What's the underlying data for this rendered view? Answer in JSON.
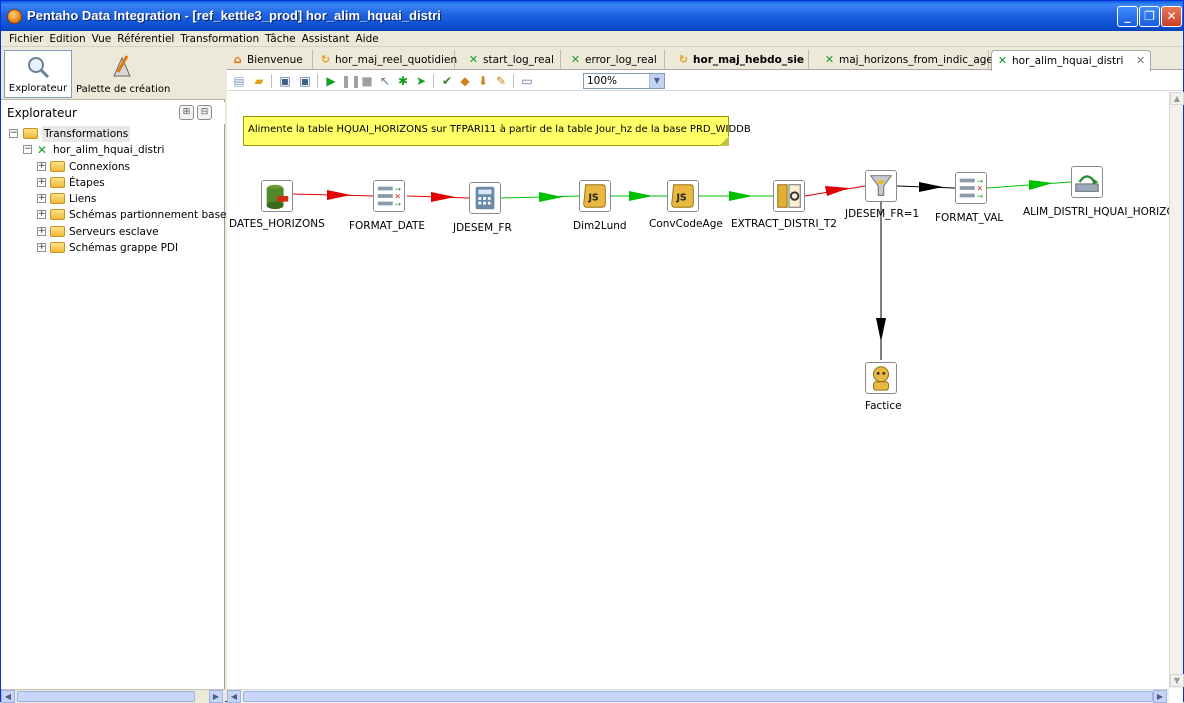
{
  "window": {
    "title": "Pentaho Data Integration - [ref_kettle3_prod] hor_alim_hquai_distri",
    "buttons": {
      "minimize": "_",
      "maximize": "❐",
      "close": "✕"
    }
  },
  "menubar": {
    "items": [
      "Fichier",
      "Edition",
      "Vue",
      "Référentiel",
      "Transformation",
      "Tâche",
      "Assistant",
      "Aide"
    ]
  },
  "perspectives": {
    "explorer": "Explorateur",
    "palette": "Palette de création"
  },
  "explorer": {
    "title": "Explorateur",
    "tree": {
      "root": "Transformations",
      "transformation": "hor_alim_hquai_distri",
      "children": [
        "Connexions",
        "Étapes",
        "Liens",
        "Schémas partionnement bases",
        "Serveurs esclave",
        "Schémas grappe PDI"
      ]
    }
  },
  "tabs": [
    {
      "label": "Bienvenue",
      "icon": "welcome-icon",
      "active": false
    },
    {
      "label": "hor_maj_reel_quotidien",
      "icon": "job-icon",
      "active": false
    },
    {
      "label": "start_log_real",
      "icon": "transformation-icon",
      "active": false
    },
    {
      "label": "error_log_real",
      "icon": "transformation-icon",
      "active": false
    },
    {
      "label": "hor_maj_hebdo_sie",
      "icon": "job-icon",
      "active": false,
      "bold": true
    },
    {
      "label": "maj_horizons_from_indic_age",
      "icon": "transformation-icon",
      "active": false
    },
    {
      "label": "hor_alim_hquai_distri",
      "icon": "transformation-icon",
      "active": true
    }
  ],
  "toolbar": {
    "zoom": "100%"
  },
  "canvas": {
    "note": "Alimente la table HQUAI_HORIZONS sur TFPARI11 à partir de la table Jour_hz de la base PRD_WIDDB",
    "steps": {
      "dates_horizons": "DATES_HORIZONS",
      "format_date": "FORMAT_DATE",
      "jdesem_fr": "JDESEM_FR",
      "dim2lund": "Dim2Lund",
      "convcodeage": "ConvCodeAge",
      "extract_distri_t2": "EXTRACT_DISTRI_T2",
      "jdesem_fr_1": "JDESEM_FR=1",
      "format_val": "FORMAT_VAL",
      "alim_distri": "ALIM_DISTRI_HQUAI_HORIZONS",
      "factice": "Factice"
    }
  },
  "colors": {
    "titlebar": "#0A4FD0",
    "note_bg": "#FFFF66",
    "hop_red": "#E00000",
    "hop_green": "#00C000",
    "hop_black": "#000000"
  }
}
